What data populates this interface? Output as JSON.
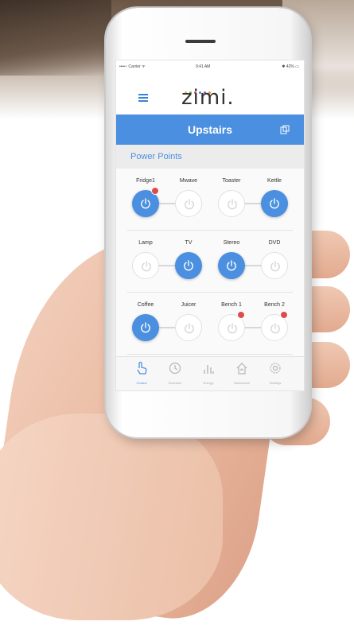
{
  "status_bar": {
    "carrier": "••••○ Carrier ᯤ",
    "time": "9:41 AM",
    "battery": "✱ 42% ▭"
  },
  "app": {
    "logo_text": "zimi.",
    "logo_dot_colors": [
      "#e6b630",
      "#59b34c",
      "#e2483e",
      "#3b82d6",
      "#9a4fc4",
      "#f08c2c"
    ]
  },
  "header": {
    "title": "Upstairs",
    "icon": "copy-icon"
  },
  "section": {
    "title": "Power Points"
  },
  "rows": [
    {
      "labels": [
        "Fridge1",
        "Mwave",
        "Toaster",
        "Kettle"
      ],
      "states": [
        "on",
        "off",
        "off",
        "on"
      ],
      "alerts": [
        true,
        false,
        false,
        false
      ]
    },
    {
      "labels": [
        "Lamp",
        "TV",
        "Stereo",
        "DVD"
      ],
      "states": [
        "off",
        "on",
        "on",
        "off"
      ],
      "alerts": [
        false,
        false,
        false,
        false
      ]
    },
    {
      "labels": [
        "Coffee",
        "Juicer",
        "Bench 1",
        "Bench 2"
      ],
      "states": [
        "on",
        "off",
        "off",
        "off"
      ],
      "alerts": [
        false,
        false,
        true,
        true
      ]
    }
  ],
  "tabs": [
    {
      "label": "Control",
      "icon": "hand-pointer-icon",
      "active": true
    },
    {
      "label": "Schedule",
      "icon": "clock-icon",
      "active": false
    },
    {
      "label": "Energy",
      "icon": "bar-chart-icon",
      "active": false
    },
    {
      "label": "Sidescreen",
      "icon": "house-icon",
      "active": false
    },
    {
      "label": "Settings",
      "icon": "gear-icon",
      "active": false
    }
  ],
  "colors": {
    "accent": "#4a8fe0",
    "alert": "#e14a4a"
  }
}
